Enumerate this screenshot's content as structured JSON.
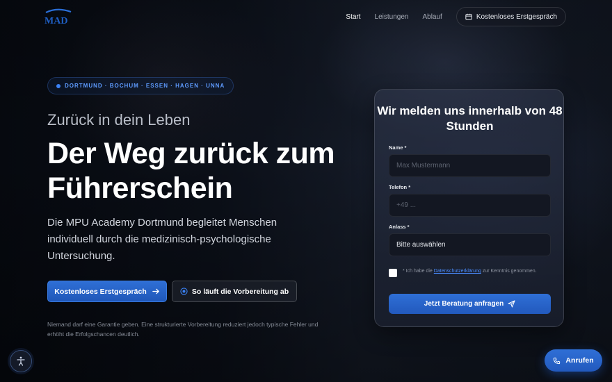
{
  "header": {
    "logo_text": "MAD",
    "nav": [
      {
        "label": "Start",
        "active": true
      },
      {
        "label": "Leistungen",
        "active": false
      },
      {
        "label": "Ablauf",
        "active": false
      }
    ],
    "cta_label": "Kostenloses Erstgespräch",
    "cta_icon": "calendar-icon"
  },
  "hero": {
    "badge": "DORTMUND · BOCHUM · ESSEN · HAGEN · UNNA",
    "subtitle": "Zurück in dein Leben",
    "headline": "Der Weg zurück zum Führerschein",
    "lead": "Die MPU Academy Dortmund begleitet Menschen individuell durch die medizinisch-psychologische Untersuchung.",
    "primary_button": "Kostenloses Erstgespräch",
    "secondary_button": "So läuft die Vorbereitung ab",
    "disclaimer": "Niemand darf eine Garantie geben. Eine strukturierte Vorbereitung reduziert jedoch typische Fehler und erhöht die Erfolgschancen deutlich."
  },
  "form": {
    "title": "Wir melden uns innerhalb von 48 Stunden",
    "name_label": "Name *",
    "name_placeholder": "Max Mustermann",
    "name_value": "",
    "phone_label": "Telefon *",
    "phone_placeholder": "+49 ...",
    "phone_value": "",
    "reason_label": "Anlass *",
    "reason_selected": "Bitte auswählen",
    "consent_prefix": "* Ich habe die",
    "consent_link": "Datenschutzerklärung",
    "consent_suffix": "zur Kenntnis genommen.",
    "consent_checked": false,
    "submit_label": "Jetzt Beratung anfragen"
  },
  "floating": {
    "call_label": "Anrufen",
    "accessibility_icon": "accessibility-icon"
  },
  "colors": {
    "accent": "#2f6fd6",
    "badge_text": "#5e9bff",
    "link": "#4a8cff"
  }
}
